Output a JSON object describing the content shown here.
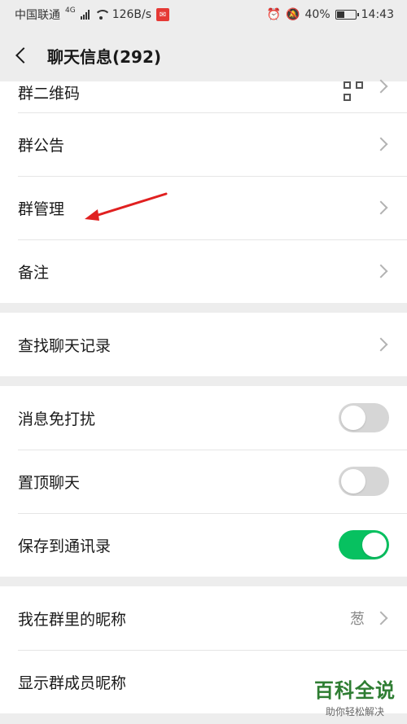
{
  "status_bar": {
    "carrier": "中国联通",
    "net_type": "4G",
    "speed": "126B/s",
    "battery": "40%",
    "time": "14:43"
  },
  "nav": {
    "title": "聊天信息(292)"
  },
  "sections": {
    "group1": {
      "qr_code": "群二维码",
      "announcement": "群公告",
      "management": "群管理",
      "remark": "备注"
    },
    "group2": {
      "search_history": "查找聊天记录"
    },
    "group3": {
      "mute": {
        "label": "消息免打扰",
        "on": false
      },
      "pin": {
        "label": "置顶聊天",
        "on": false
      },
      "save_contacts": {
        "label": "保存到通讯录",
        "on": true
      }
    },
    "group4": {
      "my_nickname": {
        "label": "我在群里的昵称",
        "value": "葱"
      },
      "show_nicknames": {
        "label": "显示群成员昵称"
      }
    }
  },
  "watermark": {
    "main": "百科全说",
    "sub": "助你轻松解决"
  },
  "colors": {
    "toggle_on": "#07c160",
    "toggle_off": "#d6d6d6",
    "annotation_arrow": "#e02020"
  }
}
